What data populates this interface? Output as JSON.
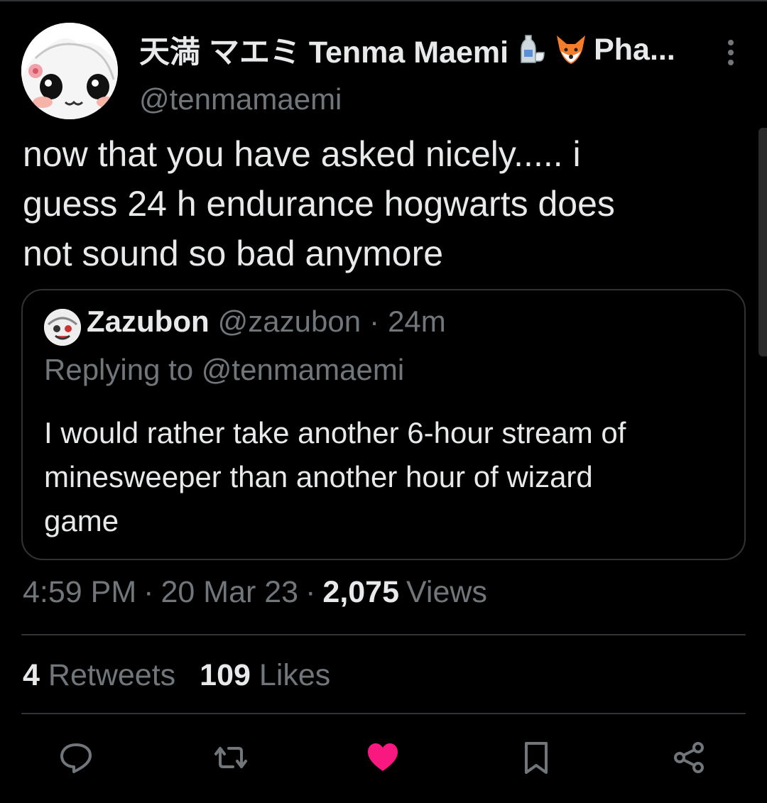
{
  "author": {
    "name": "天満 マエミ Tenma Maemi",
    "name_suffix": "Pha...",
    "handle": "@tenmamaemi",
    "emojis": [
      "sake-icon",
      "fox-icon"
    ]
  },
  "tweet": {
    "lines": [
      "now that you have asked nicely..... i",
      "guess 24 h endurance hogwarts does",
      "not sound so bad anymore"
    ]
  },
  "quote": {
    "name": "Zazubon",
    "handle": "@zazubon",
    "separator": "·",
    "time": "24m",
    "replying_to": "Replying to @tenmamaemi",
    "lines": [
      "I would rather take another 6-hour stream of",
      "minesweeper than another hour of wizard",
      "game"
    ]
  },
  "meta": {
    "time": "4:59 PM",
    "sep1": "·",
    "date": "20 Mar 23",
    "sep2": "·",
    "views_count": "2,075",
    "views_label": "Views"
  },
  "stats": {
    "retweets_count": "4",
    "retweets_label": "Retweets",
    "likes_count": "109",
    "likes_label": "Likes"
  },
  "colors": {
    "background": "#000000",
    "text": "#e7e9ea",
    "muted": "#71767b",
    "border": "#2f3336",
    "like": "#f91880"
  },
  "actions": [
    "reply-icon",
    "retweet-icon",
    "like-icon",
    "bookmark-icon",
    "share-icon"
  ]
}
